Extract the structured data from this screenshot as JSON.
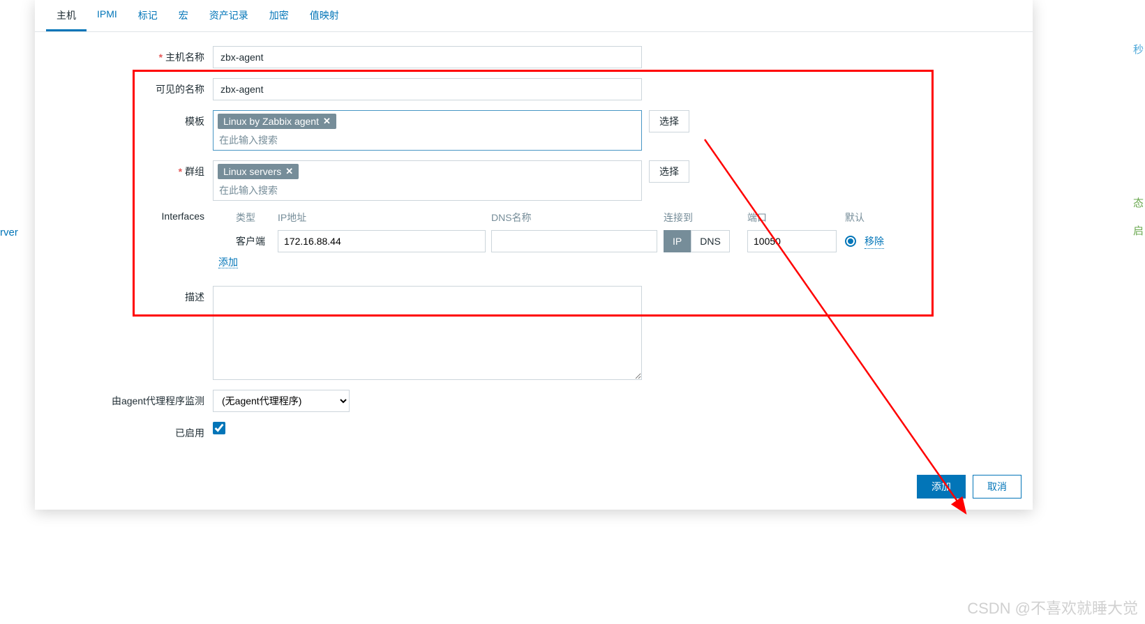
{
  "tabs": [
    "主机",
    "IPMI",
    "标记",
    "宏",
    "资产记录",
    "加密",
    "值映射"
  ],
  "labels": {
    "hostname": "主机名称",
    "visiblename": "可见的名称",
    "templates": "模板",
    "groups": "群组",
    "interfaces": "Interfaces",
    "description": "描述",
    "proxy": "由agent代理程序监测",
    "enabled": "已启用"
  },
  "values": {
    "hostname": "zbx-agent",
    "visiblename": "zbx-agent",
    "template_tag": "Linux by Zabbix agent",
    "group_tag": "Linux servers",
    "search_placeholder": "在此输入搜索",
    "select_btn": "选择",
    "proxy_option": "(无agent代理程序)"
  },
  "interfaces": {
    "headers": {
      "type": "类型",
      "ip": "IP地址",
      "dns": "DNS名称",
      "conn": "连接到",
      "port": "端口",
      "default": "默认"
    },
    "row": {
      "type": "客户端",
      "ip": "172.16.88.44",
      "dns": "",
      "conn_ip": "IP",
      "conn_dns": "DNS",
      "port": "10050",
      "remove": "移除"
    },
    "add": "添加"
  },
  "footer": {
    "add": "添加",
    "cancel": "取消"
  },
  "side": {
    "rver": "rver",
    "task": "态",
    "start": "启",
    "plus": "秒"
  },
  "watermark": "CSDN @不喜欢就睡大觉"
}
